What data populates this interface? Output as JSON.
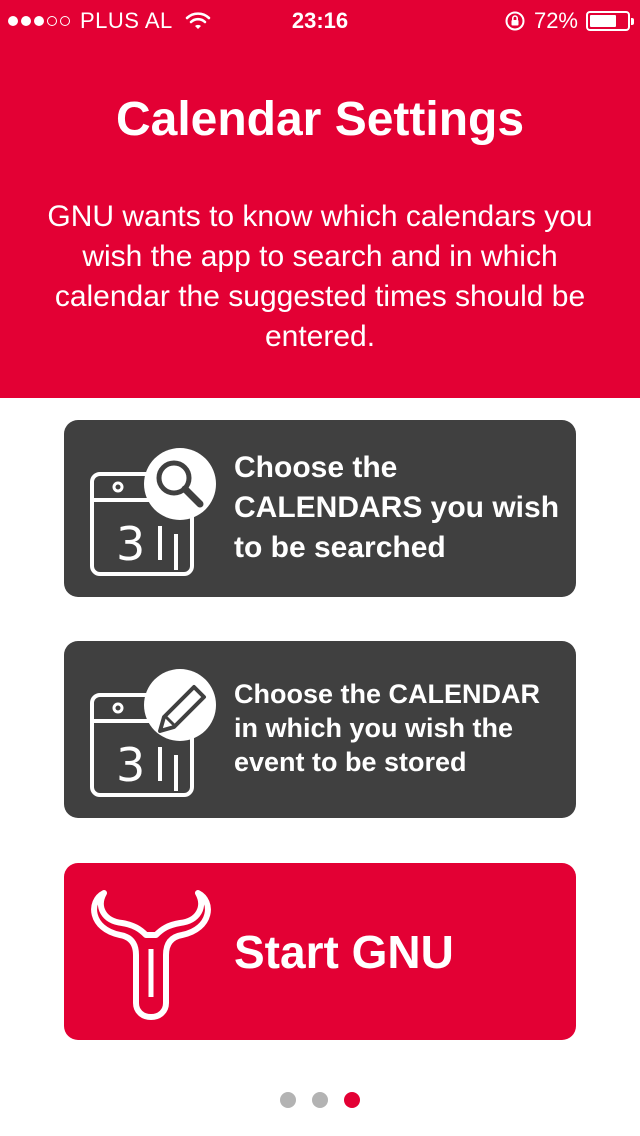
{
  "status_bar": {
    "carrier": "PLUS AL",
    "time": "23:16",
    "battery": "72%",
    "battery_level": 0.72,
    "signal_bars": 3,
    "signal_max": 5
  },
  "header": {
    "title": "Calendar Settings",
    "description": "GNU wants to know which calendars you wish the app to search and in which calendar the suggested times should be entered."
  },
  "cards": [
    {
      "label": "Choose the CALENDARS you wish to be searched",
      "icon": "calendar-search-icon"
    },
    {
      "label": "Choose the CALENDAR in which you wish the event to be stored",
      "icon": "calendar-edit-icon"
    },
    {
      "label": "Start GNU",
      "icon": "gnu-logo-icon"
    }
  ],
  "pager": {
    "count": 3,
    "active_index": 2
  },
  "colors": {
    "brand": "#e30034",
    "card_dark": "#404040",
    "pager_inactive": "#b3b3b3"
  }
}
